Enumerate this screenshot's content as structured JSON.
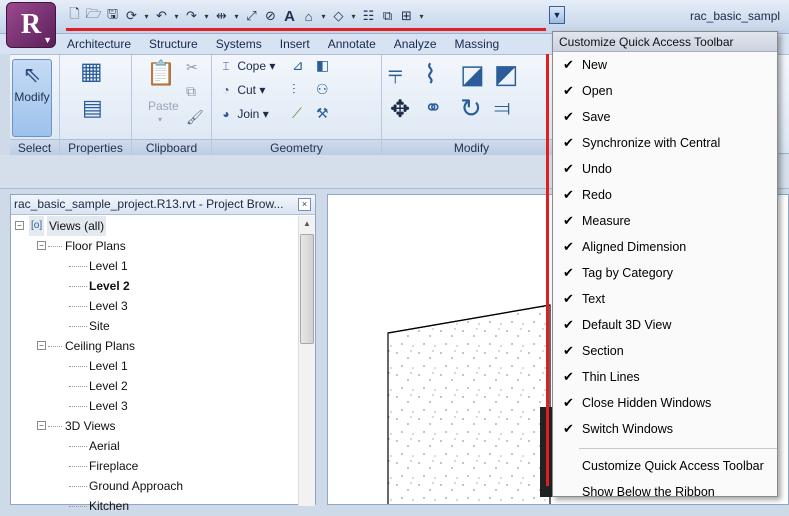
{
  "window": {
    "title": "rac_basic_sampl",
    "app_letter": "R"
  },
  "qat": {
    "icons": [
      "new-icon",
      "open-icon",
      "save-icon",
      "synchronize-icon",
      "undo-icon",
      "redo-icon",
      "measure-icon",
      "aligned-dimension-icon",
      "tag-icon",
      "text-icon",
      "3d-view-icon",
      "section-icon",
      "thin-lines-icon",
      "close-windows-icon",
      "switch-windows-icon"
    ]
  },
  "ribbon": {
    "tabs": [
      "Architecture",
      "Structure",
      "Systems",
      "Insert",
      "Annotate",
      "Analyze",
      "Massing"
    ],
    "modify_label": "Modify",
    "paste_label": "Paste",
    "cope_label": "Cope",
    "cut_label": "Cut",
    "join_label": "Join",
    "panels": {
      "select": "Select",
      "properties": "Properties",
      "clipboard": "Clipboard",
      "geometry": "Geometry",
      "modify": "Modify"
    }
  },
  "browser": {
    "title": "rac_basic_sample_project.R13.rvt - Project Brow...",
    "close_glyph": "×",
    "nodes": {
      "views_all": "Views (all)",
      "floor_plans": "Floor Plans",
      "fp_level1": "Level 1",
      "fp_level2": "Level 2",
      "fp_level3": "Level 3",
      "fp_site": "Site",
      "ceiling_plans": "Ceiling Plans",
      "cp_level1": "Level 1",
      "cp_level2": "Level 2",
      "cp_level3": "Level 3",
      "views_3d": "3D Views",
      "aerial": "Aerial",
      "fireplace": "Fireplace",
      "ground_approach": "Ground Approach",
      "kitchen": "Kitchen"
    }
  },
  "menu": {
    "header": "Customize Quick Access Toolbar",
    "items": [
      {
        "label": "New",
        "checked": "✔"
      },
      {
        "label": "Open",
        "checked": "✔"
      },
      {
        "label": "Save",
        "checked": "✔"
      },
      {
        "label": "Synchronize with Central",
        "checked": "✔"
      },
      {
        "label": "Undo",
        "checked": "✔"
      },
      {
        "label": "Redo",
        "checked": "✔"
      },
      {
        "label": "Measure",
        "checked": "✔"
      },
      {
        "label": "Aligned Dimension",
        "checked": "✔"
      },
      {
        "label": "Tag by Category",
        "checked": "✔"
      },
      {
        "label": "Text",
        "checked": "✔"
      },
      {
        "label": "Default 3D View",
        "checked": "✔"
      },
      {
        "label": "Section",
        "checked": "✔"
      },
      {
        "label": "Thin Lines",
        "checked": "✔"
      },
      {
        "label": "Close Hidden Windows",
        "checked": "✔"
      },
      {
        "label": "Switch Windows",
        "checked": "✔"
      }
    ],
    "customize": "Customize Quick Access Toolbar",
    "show_below": "Show Below the Ribbon"
  },
  "colors": {
    "highlight_red": "#e02020",
    "accent_blue": "#2a5d99"
  }
}
